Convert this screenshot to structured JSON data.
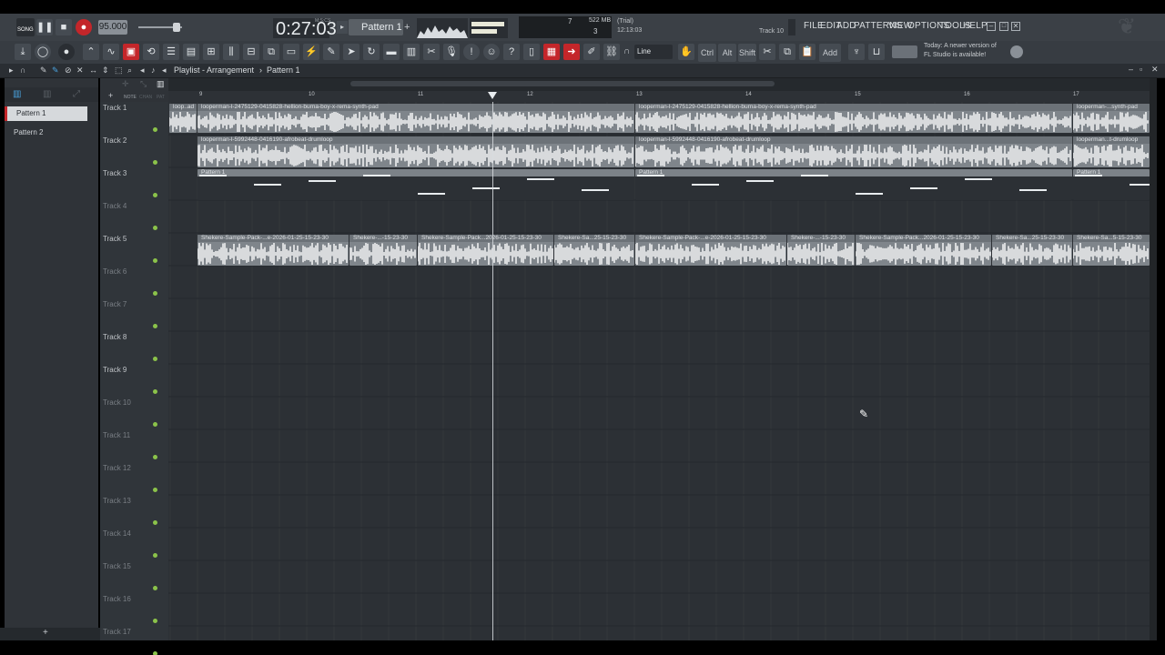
{
  "transport": {
    "song_label": "SONG",
    "tempo": "95.000",
    "time": "0:27:03",
    "time_unit": "M:S:CS",
    "pattern": "Pattern 1",
    "cpu_val": "7",
    "cpu_sub": "3",
    "mem": "522 MB",
    "trial": "(Trial)",
    "clock": "12:13:03",
    "hint_track": "Track 10"
  },
  "menu": [
    "FILE",
    "EDIT",
    "ADD",
    "PATTERNS",
    "VIEW",
    "OPTIONS",
    "TOOLS",
    "HELP"
  ],
  "toolbar2": {
    "snap": "Line",
    "mod_ctrl": "Ctrl",
    "mod_alt": "Alt",
    "mod_shift": "Shift",
    "add": "Add",
    "news_line1": "Today: A newer version of",
    "news_line2": "FL Studio is available!"
  },
  "playlist": {
    "title": "Playlist - Arrangement",
    "separator": "›",
    "current_pattern": "Pattern 1",
    "note_label": "NOTE",
    "chan_label": "CHAN",
    "pat_label": "PAT"
  },
  "picker": {
    "items": [
      "Pattern 1",
      "Pattern 2"
    ]
  },
  "ruler": [
    "9",
    "10",
    "11",
    "12",
    "13",
    "14",
    "15",
    "16",
    "17"
  ],
  "tracks": [
    "Track 1",
    "Track 2",
    "Track 3",
    "Track 4",
    "Track 5",
    "Track 6",
    "Track 7",
    "Track 8",
    "Track 9",
    "Track 10",
    "Track 11",
    "Track 12",
    "Track 13",
    "Track 14",
    "Track 15",
    "Track 16",
    "Track 17"
  ],
  "clips": {
    "t1a": "loop..ad",
    "t1b": "looperman-l-2475129-0415828-hellion-burna-boy-x-rema-synth-pad",
    "t1c": "looperman-l-2475129-0415828-hellion-burna-boy-x-rema-synth-pad",
    "t1d": "looperman-...synth-pad",
    "t2a": "looperman-l-5992448-0416190-afrobeat-drumloop",
    "t2b": "looperman-l-5992448-0416190-afrobeat-drumloop",
    "t2c": "looperman...t-drumloop",
    "t3a": "Pattern 1",
    "t3b": "Pattern 1",
    "t3c": "Pattern 1",
    "t5a": "Shekere-Sample-Pack-...e-2026-01-25-15-23-30",
    "t5b": "Shekere-...-15-23-30",
    "t5c": "Shekere-Sample-Pack...2026-01-25-15-23-30",
    "t5d": "Shekere-Sa...25-15-23-30",
    "t5e": "Shekere-Sample-Pack-...e-2026-01-25-15-23-30",
    "t5f": "Shekere-...-15-23-30",
    "t5g": "Shekere-Sample-Pack...2026-01-25-15-23-30",
    "t5h": "Shekere-Sa...25-15-23-30",
    "t5i": "Shekere-Sa...5-15-23-30"
  },
  "colors": {
    "accent_red": "#c4262a",
    "track_dot": "#8bc34a",
    "clip": "#7f858b"
  }
}
